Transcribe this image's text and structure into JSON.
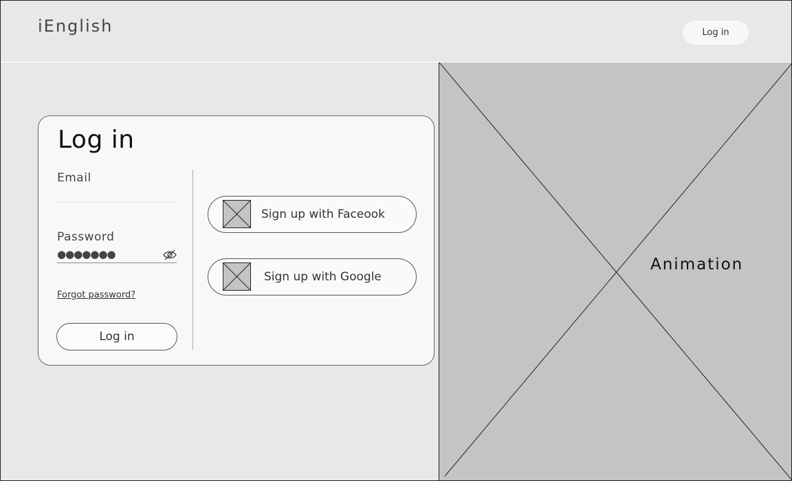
{
  "header": {
    "logo": "iEnglish",
    "login_label": "Log in"
  },
  "login_card": {
    "title": "Log in",
    "email": {
      "label": "Email",
      "value": ""
    },
    "password": {
      "label": "Password",
      "value": "●●●●●●●",
      "toggle_icon": "eye-slash-icon"
    },
    "forgot_label": "Forgot password?",
    "submit_label": "Log in"
  },
  "social": {
    "facebook_label": "Sign up with Faceook",
    "google_label": "Sign up with Google",
    "icon": "image-placeholder-icon"
  },
  "animation": {
    "label": "Animation"
  },
  "colors": {
    "background": "#e8e8e8",
    "card": "#f8f8f8",
    "placeholder": "#c4c4c4",
    "border": "#555555"
  }
}
